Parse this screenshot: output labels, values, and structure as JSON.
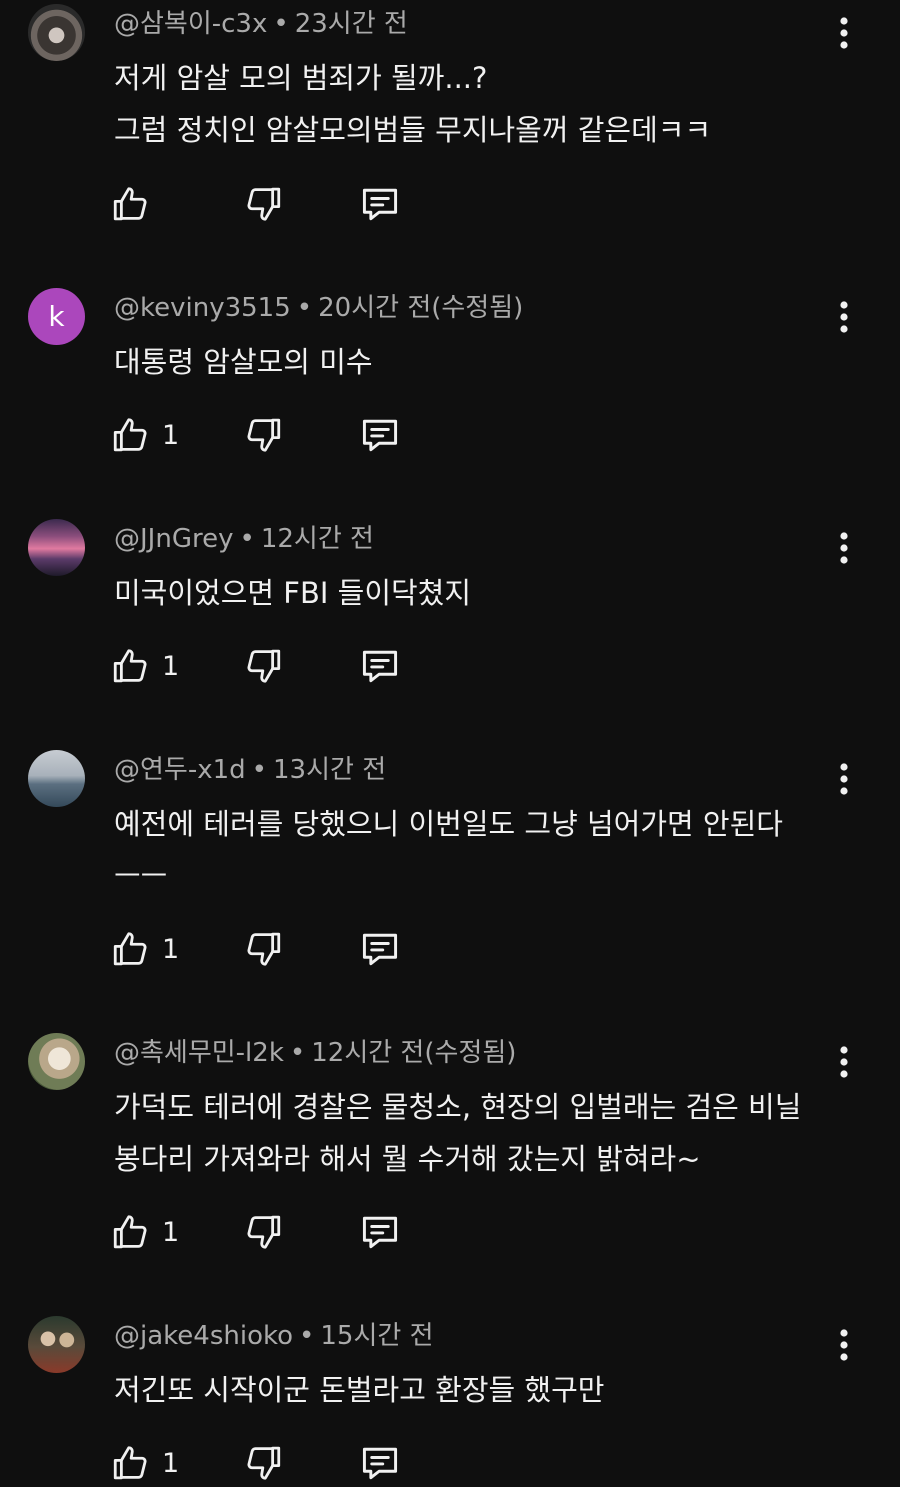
{
  "comments": [
    {
      "handle": "@삼복이-c3x",
      "time": "23시간 전",
      "lines": [
        "저게 암살 모의 범죄가 될까...?",
        "그럼 정치인 암살모의범들 무지나올꺼 같은데ㅋㅋ"
      ],
      "likes": "",
      "avatar": "dog-photo"
    },
    {
      "handle": "@keviny3515",
      "time": "20시간 전(수정됨)",
      "lines": [
        "대통령 암살모의 미수"
      ],
      "likes": "1",
      "avatar": "letter",
      "avatar_letter": "k",
      "avatar_color": "#ab47bc"
    },
    {
      "handle": "@JJnGrey",
      "time": "12시간 전",
      "lines": [
        "미국이었으면 FBI 들이닥쳤지"
      ],
      "likes": "1",
      "avatar": "sunset-photo"
    },
    {
      "handle": "@연두-x1d",
      "time": "13시간 전",
      "lines": [
        "예전에 테러를 당했으니 이번일도 그냥 넘어가면 안된다",
        "ㅡㅡ"
      ],
      "likes": "1",
      "avatar": "sea-photo"
    },
    {
      "handle": "@촉세무민-l2k",
      "time": "12시간 전(수정됨)",
      "lines": [
        "가덕도 테러에 경찰은 물청소, 현장의 입벌래는 검은 비닐",
        "봉다리 가져와라 해서 뭘 수거해 갔는지 밝혀라~"
      ],
      "likes": "1",
      "avatar": "horse-photo"
    },
    {
      "handle": "@jake4shioko",
      "time": "15시간 전",
      "lines": [
        "저긴또 시작이군 돈벌라고 환장들 했구만"
      ],
      "likes": "1",
      "avatar": "people-photo"
    }
  ],
  "separator": "•",
  "icons": {
    "like": "thumbs-up-icon",
    "dislike": "thumbs-down-icon",
    "reply": "reply-icon",
    "menu": "more-vert-icon"
  }
}
